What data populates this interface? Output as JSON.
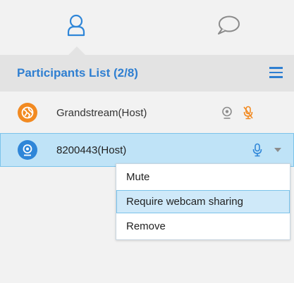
{
  "tabs": [
    {
      "icon": "participants-icon",
      "active": true
    },
    {
      "icon": "chat-icon",
      "active": false
    }
  ],
  "header": {
    "title": "Participants List (2/8)",
    "menu_icon": "hamburger-menu-icon"
  },
  "participants": [
    {
      "name": "Grandstream(Host)",
      "avatar_icon": "globe-avatar-icon",
      "avatar_color": "#f28a21",
      "webcam_icon": "webcam-icon",
      "mic_icon": "mic-muted-icon",
      "mic_color": "#f28a21"
    },
    {
      "name": "8200443(Host)",
      "avatar_icon": "webcam-avatar-icon",
      "avatar_color": "#2f86d8",
      "mic_icon": "mic-icon",
      "mic_color": "#2f86d8",
      "dropdown_icon": "caret-down-icon",
      "selected": true
    }
  ],
  "context_menu": {
    "items": [
      "Mute",
      "Require webcam sharing",
      "Remove"
    ],
    "highlighted": "Require webcam sharing"
  },
  "colors": {
    "accent": "#2f7fd1",
    "selection_bg": "#bfe3f7",
    "selection_border": "#7cc3ea",
    "panel_bg": "#f2f2f2",
    "header_bg": "#e3e3e3"
  }
}
